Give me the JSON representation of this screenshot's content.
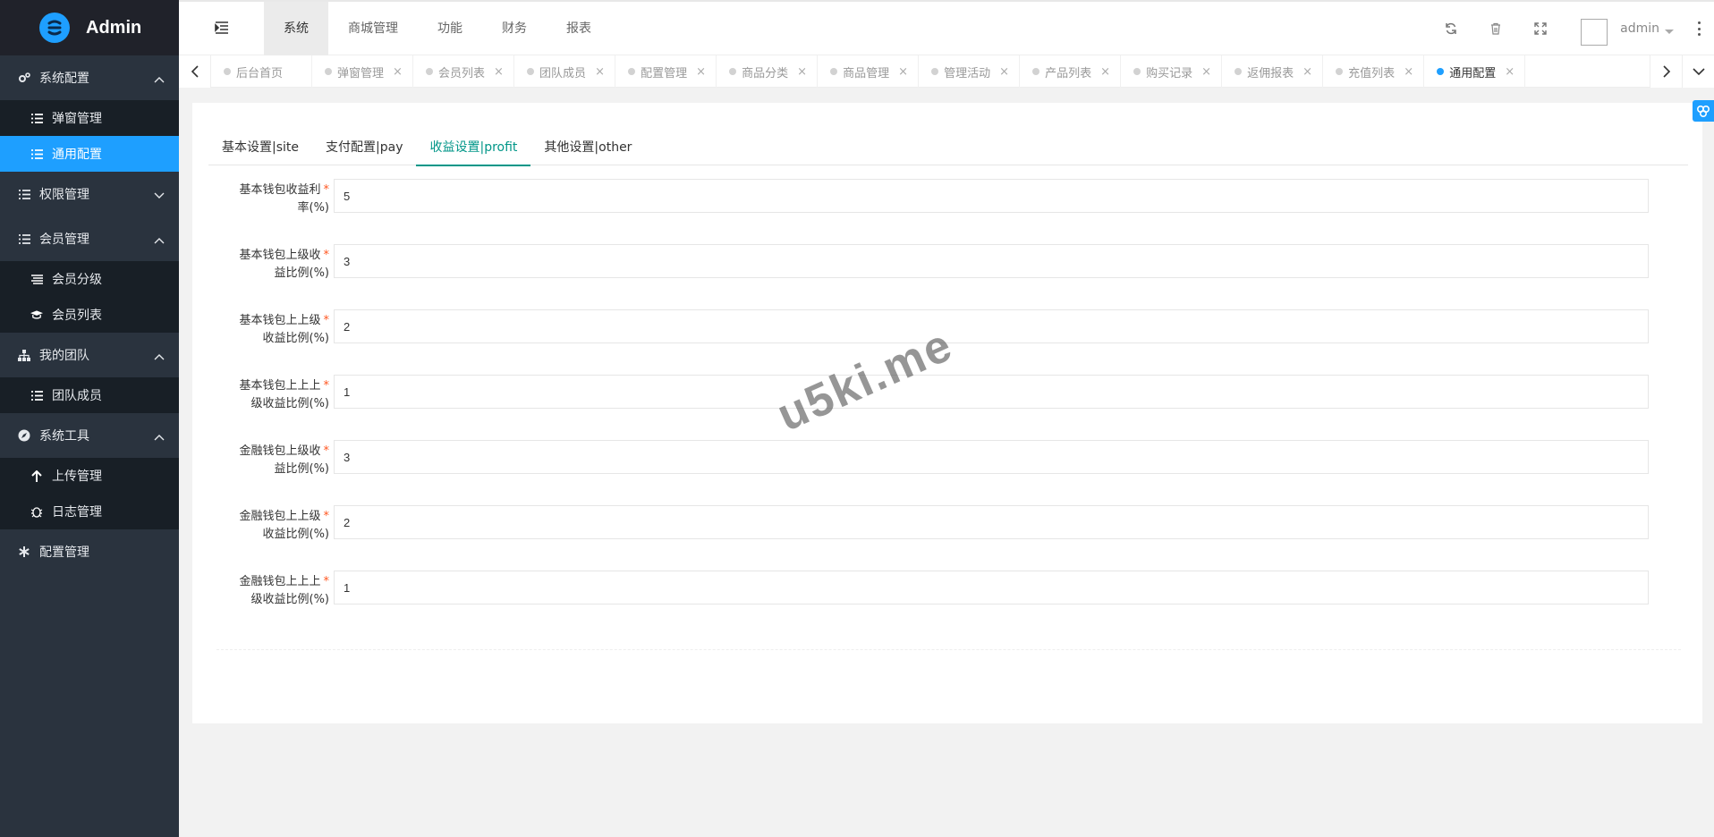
{
  "app": {
    "title": "Admin"
  },
  "sidebar": {
    "groups": [
      {
        "label": "系统配置",
        "icon": "gears-icon",
        "expanded": true,
        "items": [
          {
            "label": "弹窗管理",
            "icon": "list-icon",
            "active": false
          },
          {
            "label": "通用配置",
            "icon": "list-icon",
            "active": true
          }
        ]
      },
      {
        "label": "权限管理",
        "icon": "list-icon",
        "expanded": false,
        "items": []
      },
      {
        "label": "会员管理",
        "icon": "list-icon",
        "expanded": true,
        "items": [
          {
            "label": "会员分级",
            "icon": "align-left-icon"
          },
          {
            "label": "会员列表",
            "icon": "graduation-cap-icon"
          }
        ]
      },
      {
        "label": "我的团队",
        "icon": "sitemap-icon",
        "expanded": true,
        "items": [
          {
            "label": "团队成员",
            "icon": "list-icon"
          }
        ]
      },
      {
        "label": "系统工具",
        "icon": "compass-icon",
        "expanded": true,
        "items": [
          {
            "label": "上传管理",
            "icon": "arrow-up-icon"
          },
          {
            "label": "日志管理",
            "icon": "bug-icon"
          }
        ]
      },
      {
        "label": "配置管理",
        "icon": "asterisk-icon",
        "expanded": false,
        "items": []
      }
    ]
  },
  "topnav": {
    "items": [
      "系统",
      "商城管理",
      "功能",
      "财务",
      "报表"
    ],
    "active_index": 0,
    "user": "admin"
  },
  "tabbar": {
    "tabs": [
      {
        "label": "后台首页",
        "closable": false
      },
      {
        "label": "弹窗管理",
        "closable": true
      },
      {
        "label": "会员列表",
        "closable": true
      },
      {
        "label": "团队成员",
        "closable": true
      },
      {
        "label": "配置管理",
        "closable": true
      },
      {
        "label": "商品分类",
        "closable": true
      },
      {
        "label": "商品管理",
        "closable": true
      },
      {
        "label": "管理活动",
        "closable": true
      },
      {
        "label": "产品列表",
        "closable": true
      },
      {
        "label": "购买记录",
        "closable": true
      },
      {
        "label": "返佣报表",
        "closable": true
      },
      {
        "label": "充值列表",
        "closable": true
      },
      {
        "label": "通用配置",
        "closable": true,
        "active": true
      }
    ],
    "close_glyph": "×"
  },
  "subtabs": {
    "items": [
      "基本设置|site",
      "支付配置|pay",
      "收益设置|profit",
      "其他设置|other"
    ],
    "active_index": 2
  },
  "form": {
    "fields": [
      {
        "label_line1": "基本钱包收益利",
        "label_line2": "率(%)",
        "value": "5"
      },
      {
        "label_line1": "基本钱包上级收",
        "label_line2": "益比例(%)",
        "value": "3"
      },
      {
        "label_line1": "基本钱包上上级",
        "label_line2": "收益比例(%)",
        "value": "2"
      },
      {
        "label_line1": "基本钱包上上上",
        "label_line2": "级收益比例(%)",
        "value": "1"
      },
      {
        "label_line1": "金融钱包上级收",
        "label_line2": "益比例(%)",
        "value": "3"
      },
      {
        "label_line1": "金融钱包上上级",
        "label_line2": "收益比例(%)",
        "value": "2"
      },
      {
        "label_line1": "金融钱包上上上",
        "label_line2": "级收益比例(%)",
        "value": "1"
      }
    ],
    "required_mark": "*"
  },
  "watermark": "u5ki.me",
  "colors": {
    "sidebar_bg": "#2a333e",
    "accent": "#1e9fff",
    "subtab_active": "#009688",
    "required": "#ff5722"
  }
}
